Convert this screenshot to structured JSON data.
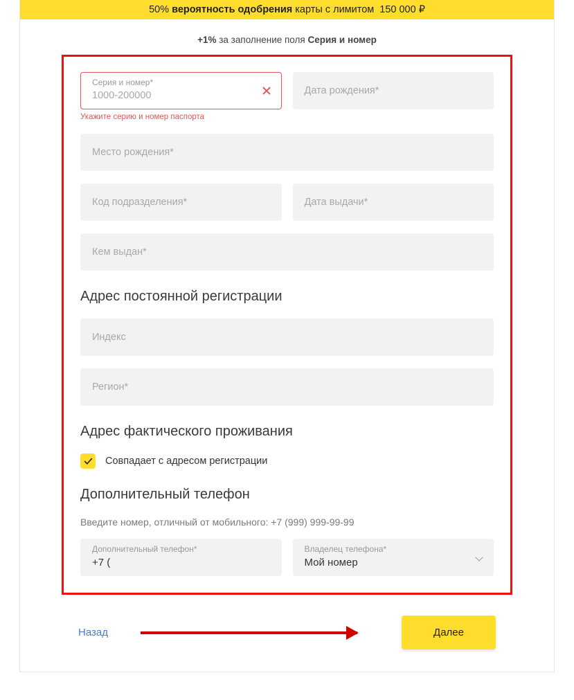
{
  "banner": {
    "percent": "50%",
    "strong": "вероятность одобрения",
    "tail": "карты с лимитом",
    "amount": "150 000 ₽"
  },
  "top_hint": {
    "plus": "+1%",
    "mid": "за заполнение поля",
    "field": "Серия и номер"
  },
  "fields": {
    "series": {
      "label": "Серия и номер*",
      "placeholder": "1000-200000",
      "error": "Укажите серию и номер паспорта"
    },
    "birth_date": {
      "placeholder": "Дата рождения*"
    },
    "birth_place": {
      "placeholder": "Место рождения*"
    },
    "dept_code": {
      "placeholder": "Код подразделения*"
    },
    "issue_date": {
      "placeholder": "Дата выдачи*"
    },
    "issued_by": {
      "placeholder": "Кем выдан*"
    },
    "postal": {
      "placeholder": "Индекс"
    },
    "region": {
      "placeholder": "Регион*"
    },
    "add_phone": {
      "label": "Дополнительный телефон*",
      "value": "+7 ("
    },
    "phone_owner": {
      "label": "Владелец телефона*",
      "value": "Мой номер"
    }
  },
  "sections": {
    "reg_address": "Адрес постоянной регистрации",
    "actual_address": "Адрес фактического проживания",
    "add_phone_title": "Дополнительный телефон"
  },
  "checkbox": {
    "label": "Совпадает с адресом регистрации"
  },
  "phone_hint": "Введите номер, отличный от мобильного: +7 (999) 999-99-99",
  "nav": {
    "back": "Назад",
    "next": "Далее"
  }
}
